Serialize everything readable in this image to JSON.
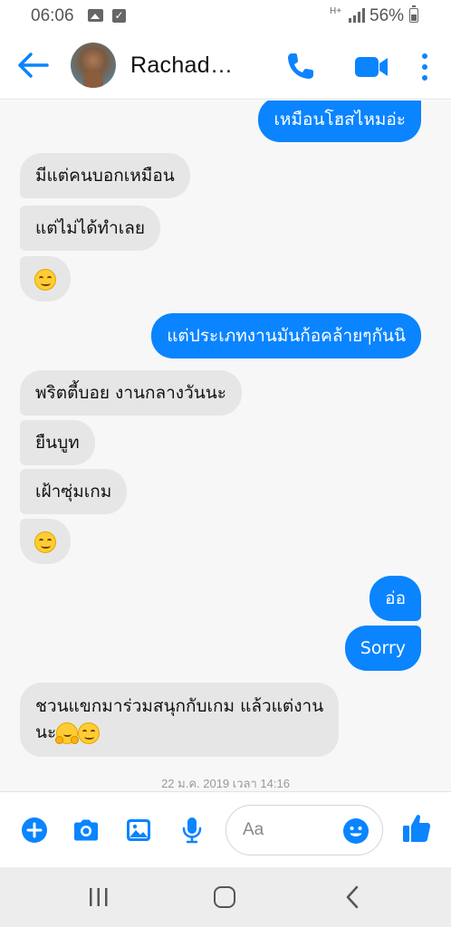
{
  "status_bar": {
    "time": "06:06",
    "network": "H+",
    "battery_percent": "56%"
  },
  "header": {
    "contact_name": "Rachad…"
  },
  "messages": [
    {
      "dir": "out",
      "text": "เหมือนโฮสไหมอ่ะ"
    },
    {
      "dir": "in",
      "text": "มีแต่คนบอกเหมือน"
    },
    {
      "dir": "in",
      "text": "แต่ไม่ได้ทำเลย"
    },
    {
      "dir": "in",
      "emoji": "smiling-face-emoji"
    },
    {
      "dir": "out",
      "text": "แต่ประเภทงานมันก้อคล้ายๆกันนิ"
    },
    {
      "dir": "in",
      "text": "พริตตี้บอย งานกลางวันนะ"
    },
    {
      "dir": "in",
      "text": "ยืนบูท"
    },
    {
      "dir": "in",
      "text": "เฝ้าซุ่มเกม"
    },
    {
      "dir": "in",
      "emoji": "smiling-face-emoji"
    },
    {
      "dir": "out",
      "text": "อ่อ"
    },
    {
      "dir": "out",
      "text": "Sorry"
    },
    {
      "dir": "in",
      "text_line1": "ชวนแขกมาร่วมสนุกกับเกม แล้วแต่งาน",
      "text_line2": "นะ"
    }
  ],
  "timestamp": "22 ม.ค. 2019 เวลา 14:16",
  "composer": {
    "placeholder": "Aa",
    "value": ""
  },
  "colors": {
    "accent": "#0a84ff",
    "incoming_bubble": "#e6e6e6",
    "chat_background": "#f7f7f7"
  }
}
